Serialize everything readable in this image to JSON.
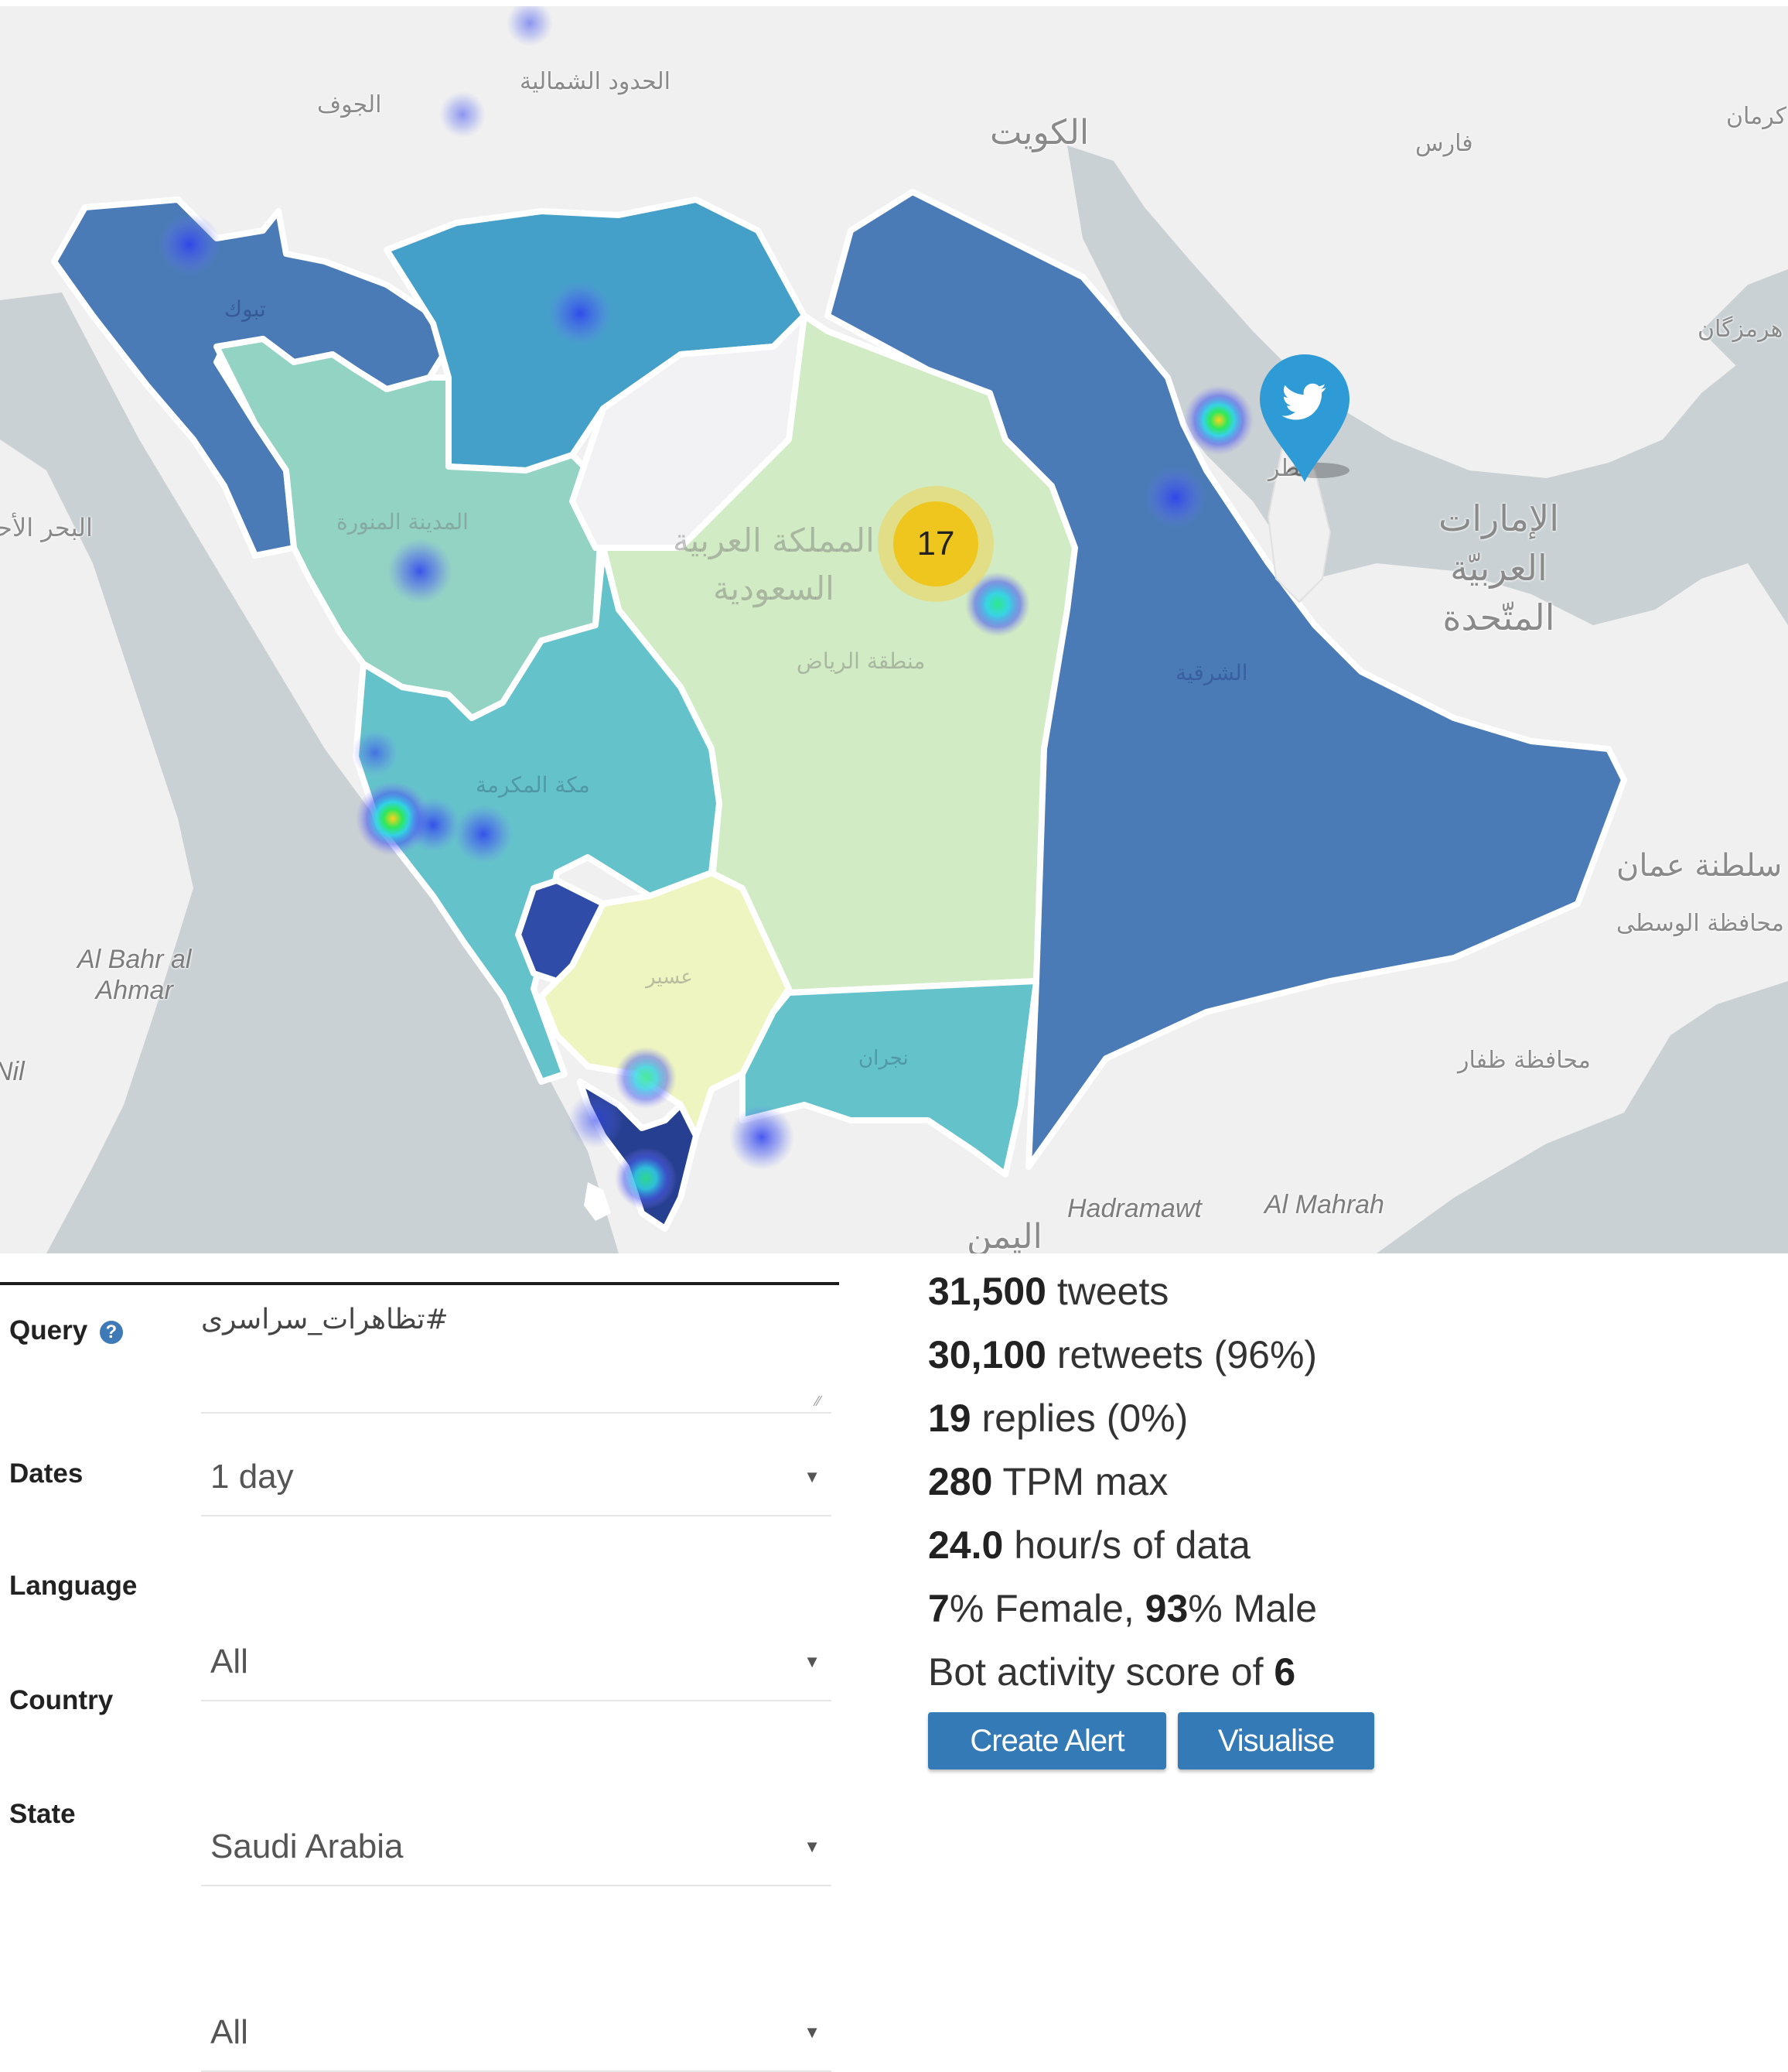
{
  "map": {
    "cluster_count": "17",
    "marker": "twitter-pin",
    "region_colors": {
      "sea": "#c9d1d4",
      "land": "#f0f0f0",
      "tabuk": "#4a7bb7",
      "eastern": "#4a7bb7",
      "northern_borders": "#45a0c9",
      "madinah": "#93d3c4",
      "makkah": "#64c2cb",
      "riyadh": "#d1ebc4",
      "qassim": "#f2f2f4",
      "asir": "#eef5c0",
      "najran": "#64c2cb",
      "baha": "#2e4ca8",
      "jazan": "#263f91"
    },
    "labels": {
      "jawf": "الجوف",
      "northern_borders": "الحدود الشمالية",
      "kuwait": "الكويت",
      "fars": "فارس",
      "kerman": "كرمان",
      "hormozgan": "هرمزگان",
      "uae": [
        "الإمارات",
        "العربيّة",
        "المتّحدة"
      ],
      "red_sea_ar": "البحر الأحمر",
      "red_sea_en": [
        "Al Bahr al",
        "Ahmar"
      ],
      "nile": "Nil",
      "oman": "سلطنة عمان",
      "al_wusta": "محافظة الوسطى",
      "dhofar": "محافظة ظفار",
      "hadramawt": "Hadramawt",
      "al_mahrah": "Al Mahrah",
      "yemen": "اليمن",
      "saudi_arabia": [
        "المملكة العربية",
        "السعودية"
      ],
      "riyadh": "منطقة الرياض",
      "eastern": "الشرقية",
      "madinah": "المدينة المنورة",
      "makkah": "مكة المكرمة",
      "asir": "عسير",
      "najran": "نجران",
      "tabuk": "تبوك",
      "qatar": "قطر"
    }
  },
  "form": {
    "query": {
      "label": "Query",
      "help_icon": "?",
      "value": "#تظاهرات_سراسری"
    },
    "dates": {
      "label": "Dates",
      "value": "1 day"
    },
    "language": {
      "label": "Language",
      "value": "All"
    },
    "country": {
      "label": "Country",
      "value": "Saudi Arabia"
    },
    "state": {
      "label": "State",
      "value": "All"
    }
  },
  "stats": {
    "tweets": {
      "value": "31,500",
      "text": " tweets"
    },
    "retweets": {
      "value": "30,100",
      "text": " retweets (96%)"
    },
    "replies": {
      "value": "19",
      "text": " replies (0%)"
    },
    "tpm": {
      "value": "280",
      "text": " TPM max"
    },
    "hours": {
      "value": "24.0",
      "text": " hour/s of data"
    },
    "gender": {
      "female_value": "7",
      "female_text": "% Female, ",
      "male_value": "93",
      "male_text": "% Male"
    },
    "bot": {
      "text": "Bot activity score of ",
      "value": "6"
    }
  },
  "buttons": {
    "create_alert": "Create Alert",
    "visualise": "Visualise"
  },
  "colors": {
    "button_primary": "#337ab7",
    "help_icon": "#3e7ab8",
    "cluster": "#f0c20c"
  }
}
